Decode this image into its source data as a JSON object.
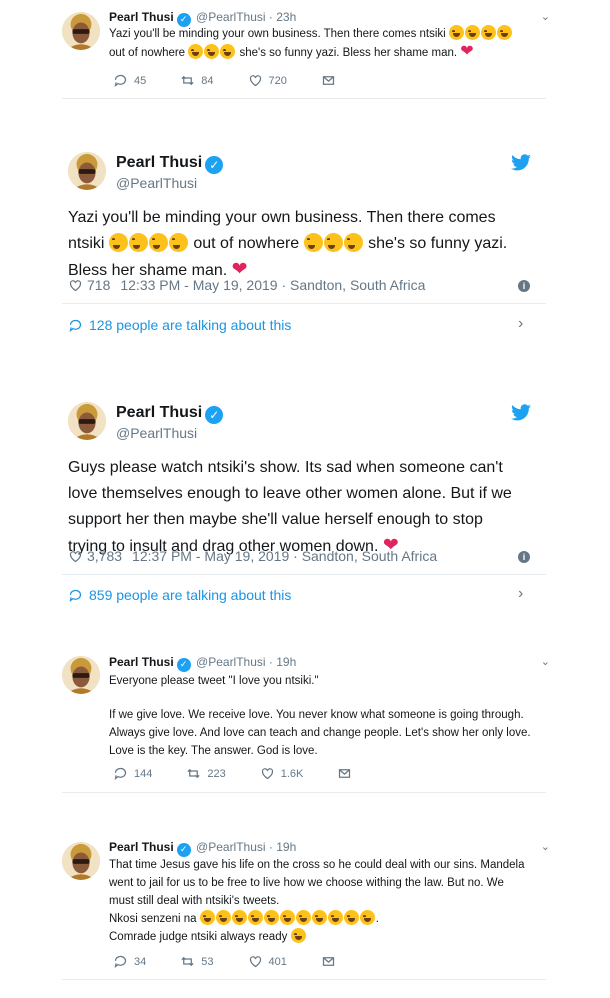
{
  "colors": {
    "accent": "#1da1f2",
    "link": "#1b95e0",
    "muted": "#657786",
    "heart": "#e0245e",
    "text": "#14171a"
  },
  "icons": {
    "reply": "reply-icon",
    "retweet": "retweet-icon",
    "like": "heart-outline-icon",
    "dm": "envelope-icon",
    "verified": "verified-badge-icon",
    "bird": "twitter-bird-icon",
    "info": "info-icon"
  },
  "tweet1": {
    "name": "Pearl Thusi",
    "handle_time": "@PearlThusi · 23h",
    "line1": "Yazi you'll be minding your own business. Then there comes ntsiki ",
    "line2a": "out of nowhere ",
    "line2b": " she's so funny yazi. Bless her shame man. ",
    "replies": "45",
    "retweets": "84",
    "likes": "720"
  },
  "card1": {
    "name": "Pearl Thusi",
    "handle": "@PearlThusi",
    "line1": "Yazi you'll be minding your own business. Then there comes",
    "line2a": "ntsiki ",
    "line2b": " out of nowhere ",
    "line2c": " she's so funny yazi.",
    "line3": "Bless her shame man. ",
    "likes": "718",
    "datetime": "12:33 PM - May 19, 2019 · Sandton, South Africa",
    "talking": "128 people are talking about this"
  },
  "card2": {
    "name": "Pearl Thusi",
    "handle": "@PearlThusi",
    "line1": "Guys please watch ntsiki's show. Its sad when someone can't",
    "line2": "love themselves enough to leave other women alone. But if we",
    "line3": "support her then maybe she'll value herself enough to stop",
    "line4": "trying to insult and drag other women down. ",
    "likes": "3,783",
    "datetime": "12:37 PM - May 19, 2019 · Sandton, South Africa",
    "talking": "859 people are talking about this"
  },
  "tweet2": {
    "name": "Pearl Thusi",
    "handle_time": "@PearlThusi · 19h",
    "line1": "Everyone please tweet \"I love you ntsiki.\"",
    "line2": "If we give love. We receive love. You never know what someone is going through.",
    "line3": "Always give love. And love can teach and change people. Let's show her only love.",
    "line4": "Love is the key. The answer. God is love.",
    "replies": "144",
    "retweets": "223",
    "likes": "1.6K"
  },
  "tweet3": {
    "name": "Pearl Thusi",
    "handle_time": "@PearlThusi · 19h",
    "line1": "That time Jesus gave his life on the cross so he could deal with our sins. Mandela",
    "line2": "went to jail for us to be free to live how we choose withing the law. But no. We",
    "line3": "must still deal with ntsiki's tweets.",
    "line4": "Nkosi senzeni na ",
    "line4end": ".",
    "line5": "Comrade judge ntsiki always ready ",
    "replies": "34",
    "retweets": "53",
    "likes": "401"
  }
}
